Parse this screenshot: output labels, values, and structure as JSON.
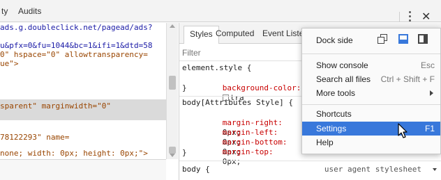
{
  "top_tabs": [
    "ty",
    "Audits"
  ],
  "source_lines": [
    {
      "segments": [
        {
          "t": "ads.g.doubleclick.net/pagead/ads?",
          "c": "c-url"
        }
      ]
    },
    {
      "segments": [
        {
          "t": "",
          "c": "c-text"
        }
      ]
    },
    {
      "segments": [
        {
          "t": "u&pfx=0&fu=1044&bc=1&ifi=1&dtd=58",
          "c": "c-url"
        }
      ]
    },
    {
      "segments": [
        {
          "t": "0\" hspace=\"0\" allowtransparency=",
          "c": "c-attr"
        }
      ]
    },
    {
      "segments": [
        {
          "t": "ue\">",
          "c": "c-attr"
        }
      ]
    },
    {
      "segments": [
        {
          "t": "",
          "c": "c-text"
        }
      ]
    },
    {
      "segments": [
        {
          "t": "",
          "c": "c-text"
        }
      ]
    },
    {
      "segments": [
        {
          "t": "",
          "c": "c-text"
        }
      ]
    },
    {
      "segments": [
        {
          "t": "sparent\" marginwidth=\"0\"",
          "c": "c-attr"
        }
      ]
    },
    {
      "segments": [
        {
          "t": "",
          "c": "c-text"
        }
      ]
    },
    {
      "segments": [
        {
          "t": "",
          "c": "c-text"
        }
      ]
    },
    {
      "segments": [
        {
          "t": "78122293\" name=",
          "c": "c-attr"
        }
      ]
    },
    {
      "segments": [
        {
          "t": "none; width: 0px; height: 0px;\">",
          "c": "c-attr"
        }
      ]
    }
  ],
  "styles_tabs": [
    "Styles",
    "Computed",
    "Event Liste"
  ],
  "filter_placeholder": "Filter",
  "rules": {
    "element_style": {
      "selector": "element.style {",
      "prop": "background-color:",
      "value": "tra",
      "close": "}"
    },
    "attr_style": {
      "selector": "body[Attributes Style] {",
      "decls": [
        {
          "prop": "margin-right:",
          "value": "0px;"
        },
        {
          "prop": "margin-left:",
          "value": "0px;"
        },
        {
          "prop": "margin-bottom:",
          "value": "0px;"
        },
        {
          "prop": "margin-top:",
          "value": "0px;"
        }
      ],
      "close": "}"
    },
    "body_rule": {
      "selector": "body {"
    },
    "ua_label": "user agent stylesheet"
  },
  "menu": {
    "dock_side_label": "Dock side",
    "items": [
      {
        "label": "Show console",
        "shortcut": "Esc"
      },
      {
        "label": "Search all files",
        "shortcut": "Ctrl + Shift + F"
      },
      {
        "label": "More tools",
        "shortcut": ""
      }
    ],
    "items2": [
      {
        "label": "Shortcuts",
        "shortcut": ""
      },
      {
        "label": "Settings",
        "shortcut": "F1"
      },
      {
        "label": "Help",
        "shortcut": ""
      }
    ],
    "selected": "Settings",
    "accent": "#3878db"
  },
  "close_glyph": "✕"
}
